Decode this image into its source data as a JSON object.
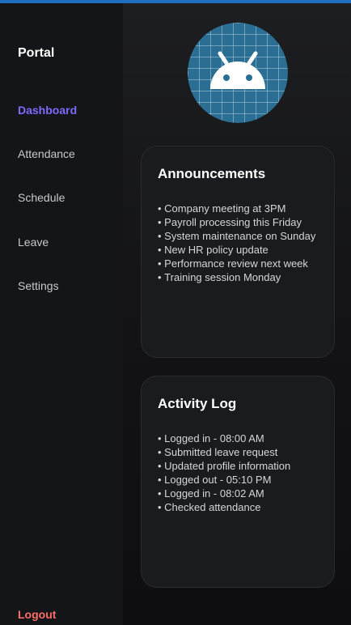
{
  "sidebar": {
    "brand": "Portal",
    "items": [
      {
        "label": "Dashboard",
        "active": true
      },
      {
        "label": "Attendance",
        "active": false
      },
      {
        "label": "Schedule",
        "active": false
      },
      {
        "label": "Leave",
        "active": false
      },
      {
        "label": "Settings",
        "active": false
      }
    ],
    "logout": "Logout"
  },
  "main": {
    "avatar": {
      "icon": "android-icon"
    },
    "announcements": {
      "title": "Announcements",
      "items": [
        "Company meeting at 3PM",
        "Payroll processing this Friday",
        "System maintenance on Sunday",
        "New HR policy update",
        "Performance review next week",
        "Training session Monday"
      ]
    },
    "activity": {
      "title": "Activity Log",
      "items": [
        "Logged in - 08:00 AM",
        "Submitted leave request",
        "Updated profile information",
        "Logged out - 05:10 PM",
        "Logged in - 08:02 AM",
        "Checked attendance"
      ]
    }
  },
  "colors": {
    "accent_active": "#7c6cff",
    "logout": "#ff6e66",
    "avatar_bg": "#2a6f93",
    "android_head": "#ffffff"
  }
}
